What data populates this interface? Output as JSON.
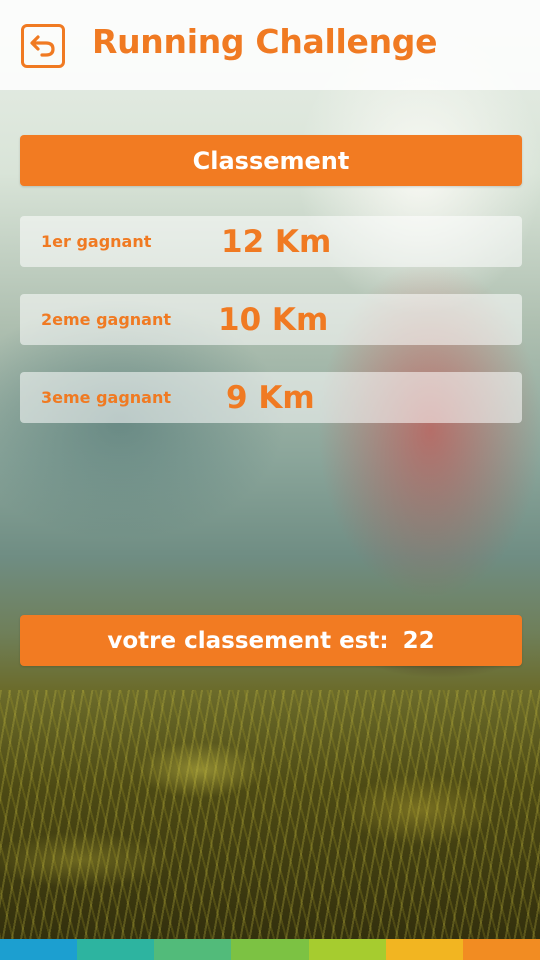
{
  "header": {
    "title": "Running Challenge",
    "back_icon": "back-arrow-icon"
  },
  "ranking": {
    "heading": "Classement",
    "rows": [
      {
        "label": "1er gagnant",
        "value": "12 Km"
      },
      {
        "label": "2eme gagnant",
        "value": "10 Km"
      },
      {
        "label": "3eme gagnant",
        "value": "9 Km"
      }
    ]
  },
  "user_rank": {
    "label": "votre classement est:",
    "value": "22"
  },
  "colors": {
    "accent": "#f27b22",
    "strip": [
      "#1c9fd0",
      "#2db4a0",
      "#52bb7a",
      "#7cc243",
      "#a6cc2f",
      "#f2b521",
      "#f28c22"
    ]
  }
}
